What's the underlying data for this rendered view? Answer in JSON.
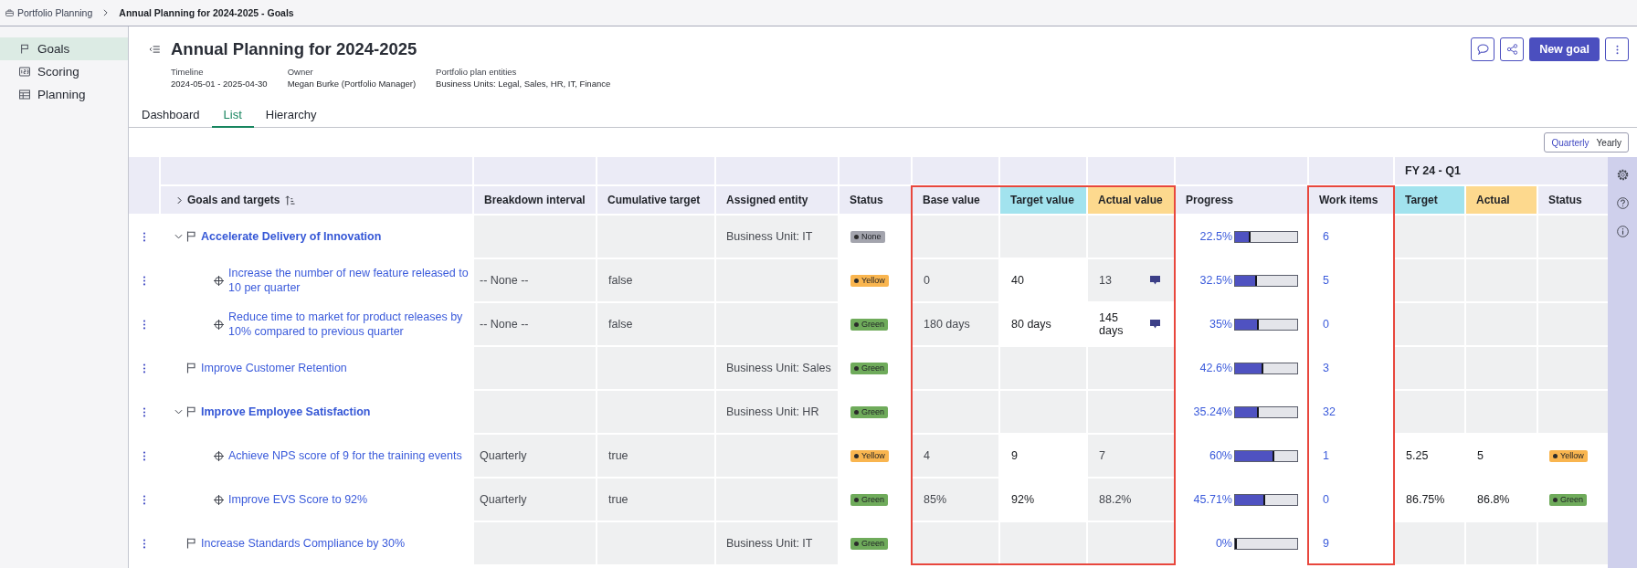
{
  "breadcrumb": [
    "Portfolio Planning",
    "Annual Planning for 2024-2025 - Goals"
  ],
  "sidebar": {
    "items": [
      {
        "label": "Goals",
        "selected": true
      },
      {
        "label": "Scoring",
        "selected": false
      },
      {
        "label": "Planning",
        "selected": false
      }
    ]
  },
  "header": {
    "title": "Annual Planning for 2024-2025",
    "meta": [
      {
        "label": "Timeline",
        "value": "2024-05-01 - 2025-04-30"
      },
      {
        "label": "Owner",
        "value": "Megan Burke (Portfolio Manager)"
      },
      {
        "label": "Portfolio plan entities",
        "value": "Business Units: Legal, Sales, HR, IT, Finance"
      }
    ],
    "primary_action": "New goal"
  },
  "tabs": [
    {
      "label": "Dashboard",
      "selected": false
    },
    {
      "label": "List",
      "selected": true
    },
    {
      "label": "Hierarchy",
      "selected": false
    }
  ],
  "view_toggle": [
    {
      "label": "Quarterly",
      "selected": true
    },
    {
      "label": "Yearly",
      "selected": false
    }
  ],
  "table": {
    "columns": [
      {
        "label": "Goals and targets",
        "color": "#ebebf6",
        "highlighted": false
      },
      {
        "label": "Breakdown interval",
        "color": "#ebebf6",
        "highlighted": false
      },
      {
        "label": "Cumulative target",
        "color": "#ebebf6",
        "highlighted": false
      },
      {
        "label": "Assigned entity",
        "color": "#ebebf6",
        "highlighted": false
      },
      {
        "label": "Status",
        "color": "#ebebf6",
        "highlighted": false
      },
      {
        "label": "Base value",
        "color": "#ebebf6",
        "highlighted": true
      },
      {
        "label": "Target value",
        "color": "#a2e3ee",
        "highlighted": true
      },
      {
        "label": "Actual value",
        "color": "#fdd98e",
        "highlighted": true
      },
      {
        "label": "Progress",
        "color": "#ebebf6",
        "highlighted": false
      },
      {
        "label": "Work items",
        "color": "#ebebf6",
        "highlighted": true
      }
    ],
    "quarter": {
      "label": "FY 24 - Q1",
      "columns": [
        {
          "label": "Target",
          "color": "#a2e3ee",
          "highlighted": false
        },
        {
          "label": "Actual",
          "color": "#fdd98e",
          "highlighted": false
        },
        {
          "label": "Status",
          "color": "#ebebf6",
          "highlighted": false
        }
      ]
    },
    "rows": [
      {
        "name": "Accelerate Delivery of Innovation",
        "kind": "goal",
        "expanded": true,
        "assigned_entity": "Business Unit: IT",
        "status": {
          "label": "None",
          "color": "#a3a4ad"
        },
        "progress": {
          "text": "22.5%",
          "level": 0.225
        },
        "work_items": "6",
        "children": [
          {
            "name": "Increase the number of new feature released to 10 per quarter",
            "kind": "target",
            "breakdown_interval": "-- None --",
            "cumulative_target": "false",
            "status": {
              "label": "Yellow",
              "color": "#f9b54f"
            },
            "base_value": {
              "text": "0",
              "editable": false
            },
            "target_value": {
              "text": "40",
              "editable": true
            },
            "actual_value": {
              "text": "13",
              "editable": false,
              "comment": true
            },
            "progress": {
              "text": "32.5%",
              "level": 0.325
            },
            "work_items": "5"
          },
          {
            "name": "Reduce time to market for product releases by 10% compared to previous quarter",
            "kind": "target",
            "breakdown_interval": "-- None --",
            "cumulative_target": "false",
            "status": {
              "label": "Green",
              "color": "#6fab5b"
            },
            "base_value": {
              "text": "180 days",
              "editable": false
            },
            "target_value": {
              "text": "80 days",
              "editable": true
            },
            "actual_value": {
              "text": "145 days",
              "editable": true,
              "comment": true
            },
            "progress": {
              "text": "35%",
              "level": 0.35
            },
            "work_items": "0"
          }
        ]
      },
      {
        "name": "Improve Customer Retention",
        "kind": "goal",
        "assigned_entity": "Business Unit: Sales",
        "status": {
          "label": "Green",
          "color": "#6fab5b"
        },
        "progress": {
          "text": "42.6%",
          "level": 0.426
        },
        "work_items": "3"
      },
      {
        "name": "Improve Employee Satisfaction",
        "kind": "goal",
        "expanded": true,
        "assigned_entity": "Business Unit: HR",
        "status": {
          "label": "Green",
          "color": "#6fab5b"
        },
        "progress": {
          "text": "35.24%",
          "level": 0.3524
        },
        "work_items": "32",
        "children": [
          {
            "name": "Achieve NPS score of 9 for the training events",
            "kind": "target",
            "breakdown_interval": "Quarterly",
            "cumulative_target": "true",
            "status": {
              "label": "Yellow",
              "color": "#f9b54f"
            },
            "base_value": {
              "text": "4",
              "editable": false
            },
            "target_value": {
              "text": "9",
              "editable": true
            },
            "actual_value": {
              "text": "7",
              "editable": false
            },
            "progress": {
              "text": "60%",
              "level": 0.6
            },
            "work_items": "1",
            "quarter": {
              "target": {
                "text": "5.25",
                "editable": true
              },
              "actual": {
                "text": "5",
                "editable": true
              },
              "status": {
                "label": "Yellow",
                "color": "#f9b54f",
                "editable": true
              }
            }
          },
          {
            "name": "Improve EVS Score to 92%",
            "kind": "target",
            "breakdown_interval": "Quarterly",
            "cumulative_target": "true",
            "status": {
              "label": "Green",
              "color": "#6fab5b"
            },
            "base_value": {
              "text": "85%",
              "editable": false
            },
            "target_value": {
              "text": "92%",
              "editable": true
            },
            "actual_value": {
              "text": "88.2%",
              "editable": false
            },
            "progress": {
              "text": "45.71%",
              "level": 0.4571
            },
            "work_items": "0",
            "quarter": {
              "target": {
                "text": "86.75%",
                "editable": true
              },
              "actual": {
                "text": "86.8%",
                "editable": true
              },
              "status": {
                "label": "Green",
                "color": "#6fab5b",
                "editable": true
              }
            }
          }
        ]
      },
      {
        "name": "Increase Standards Compliance by 30%",
        "kind": "goal",
        "assigned_entity": "Business Unit: IT",
        "status": {
          "label": "Green",
          "color": "#6fab5b"
        },
        "progress": {
          "text": "0%",
          "level": 0
        },
        "work_items": "9"
      }
    ]
  }
}
